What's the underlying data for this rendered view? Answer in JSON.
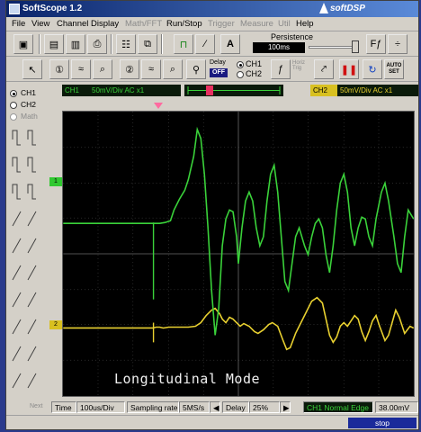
{
  "window": {
    "title": "SoftScope 1.2",
    "brand": "softDSP"
  },
  "menu": [
    "File",
    "View",
    "Channel",
    "Display",
    "Math/FFT",
    "Run/Stop",
    "Trigger",
    "Measure",
    "Util",
    "Help"
  ],
  "menu_disabled": [
    "Math/FFT",
    "Trigger",
    "Measure",
    "Util"
  ],
  "toolbar": {
    "persistence_label": "Persistence",
    "persistence_value": "100ms",
    "delay_label": "Delay",
    "delay_state": "OFF",
    "ch1_radio": "CH1",
    "ch2_radio": "CH2",
    "horiz_trig": "Horiz Trig",
    "auto_set": "AUTO SET"
  },
  "channels": {
    "ch1": {
      "tag": "CH1",
      "setting": "50mV/Div AC x1",
      "marker": "1",
      "color": "#3ad23a"
    },
    "ch2": {
      "tag": "CH2",
      "setting": "50mV/Div AC x1",
      "marker": "2",
      "color": "#e8d030"
    }
  },
  "sidebar": {
    "ch1": "CH1",
    "ch2": "CH2",
    "math": "Math",
    "next": "Next"
  },
  "scope": {
    "caption": "Longitudinal Mode",
    "background": "#000000"
  },
  "status": {
    "time_label": "Time",
    "time_value": "100us/Div",
    "sampling_label": "Sampling rate",
    "sampling_value": "5MS/s",
    "delay_label": "Delay",
    "delay_value": "25%",
    "trigger": "CH1 Normal Edge",
    "trigger_level": "38.00mV",
    "run_state": "stop"
  }
}
